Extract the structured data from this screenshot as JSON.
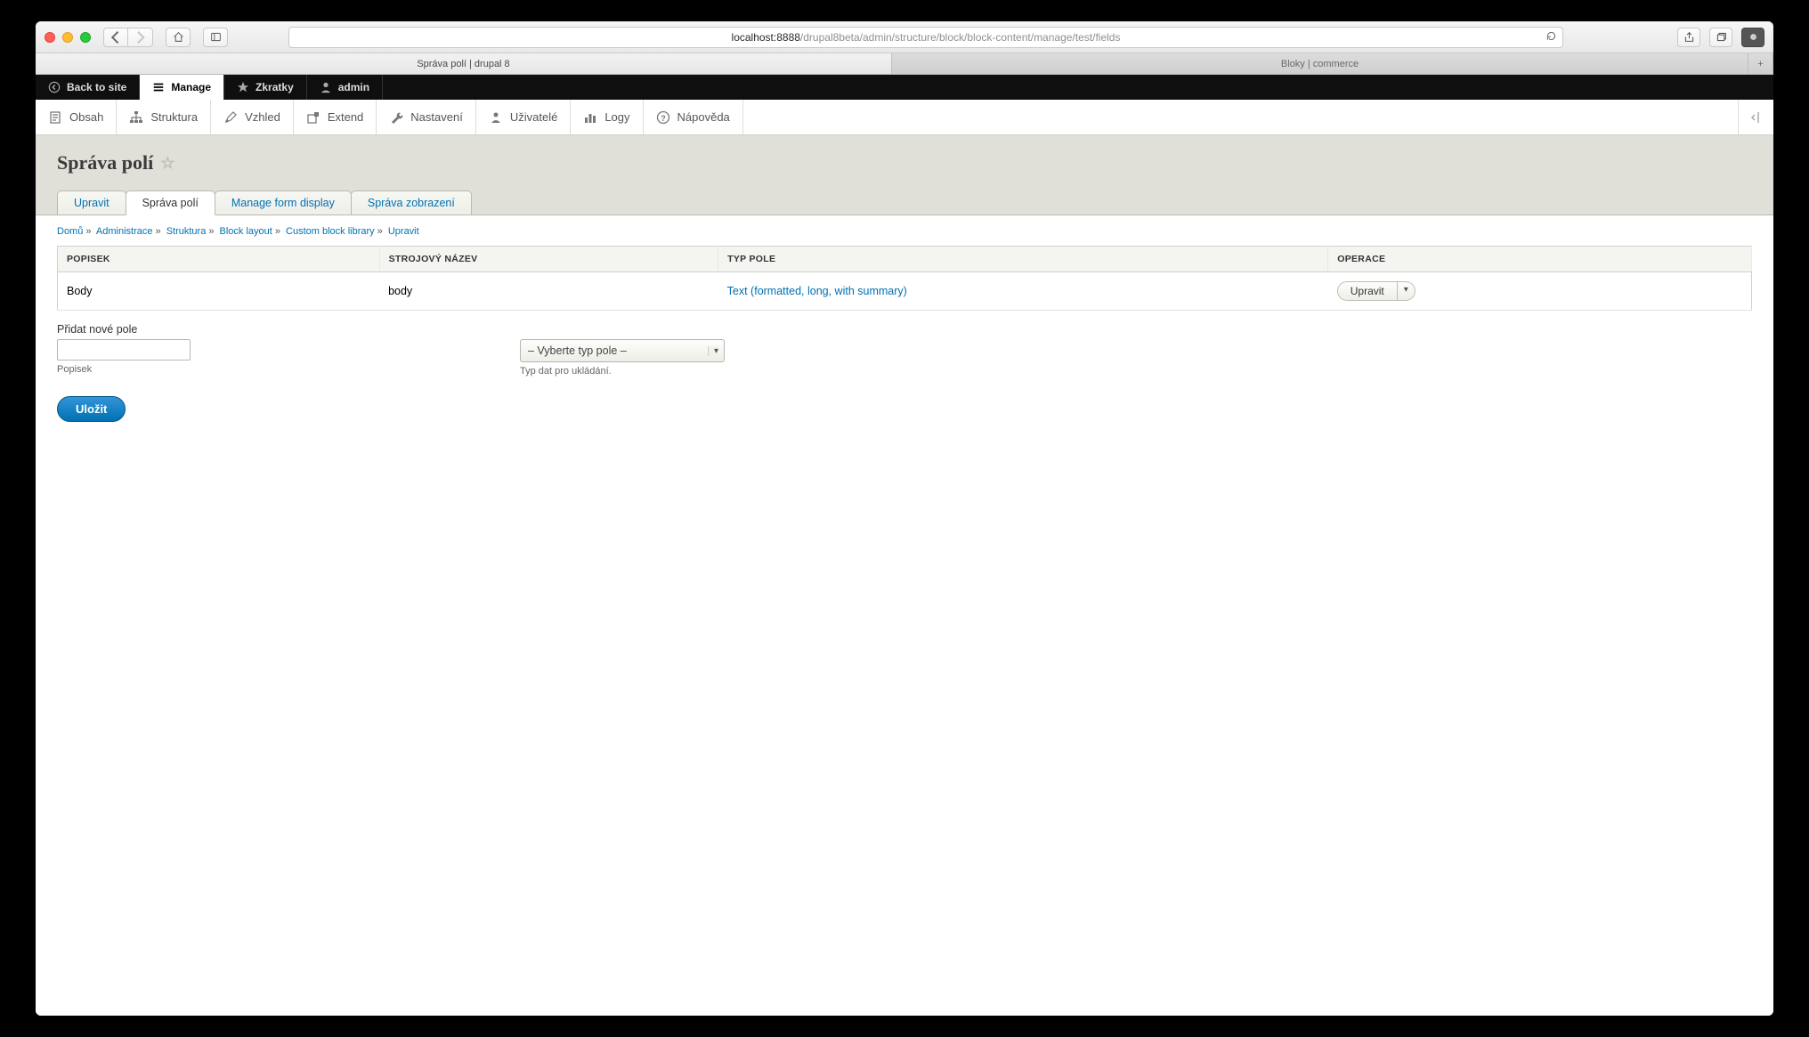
{
  "browser": {
    "url_host": "localhost:8888",
    "url_path": "/drupal8beta/admin/structure/block/block-content/manage/test/fields",
    "tabs": [
      {
        "label": "Správa polí | drupal 8",
        "active": true
      },
      {
        "label": "Bloky | commerce",
        "active": false
      }
    ]
  },
  "toolbar": {
    "back_to_site": "Back to site",
    "manage": "Manage",
    "shortcuts": "Zkratky",
    "admin": "admin"
  },
  "admin_menu": {
    "items": [
      "Obsah",
      "Struktura",
      "Vzhled",
      "Extend",
      "Nastavení",
      "Uživatelé",
      "Logy",
      "Nápověda"
    ]
  },
  "page": {
    "title": "Správa polí"
  },
  "local_tabs": [
    {
      "label": "Upravit",
      "active": false
    },
    {
      "label": "Správa polí",
      "active": true
    },
    {
      "label": "Manage form display",
      "active": false
    },
    {
      "label": "Správa zobrazení",
      "active": false
    }
  ],
  "breadcrumb": [
    "Domů",
    "Administrace",
    "Struktura",
    "Block layout",
    "Custom block library",
    "Upravit"
  ],
  "table": {
    "headers": {
      "label": "POPISEK",
      "machine": "STROJOVÝ NÁZEV",
      "type": "TYP POLE",
      "ops": "OPERACE"
    },
    "rows": [
      {
        "label": "Body",
        "machine": "body",
        "type": "Text (formatted, long, with summary)",
        "op": "Upravit"
      }
    ]
  },
  "add_field": {
    "section_label": "Přidat nové pole",
    "label_desc": "Popisek",
    "type_placeholder": "– Vyberte typ pole –",
    "type_desc": "Typ dat pro ukládání."
  },
  "submit": "Uložit"
}
